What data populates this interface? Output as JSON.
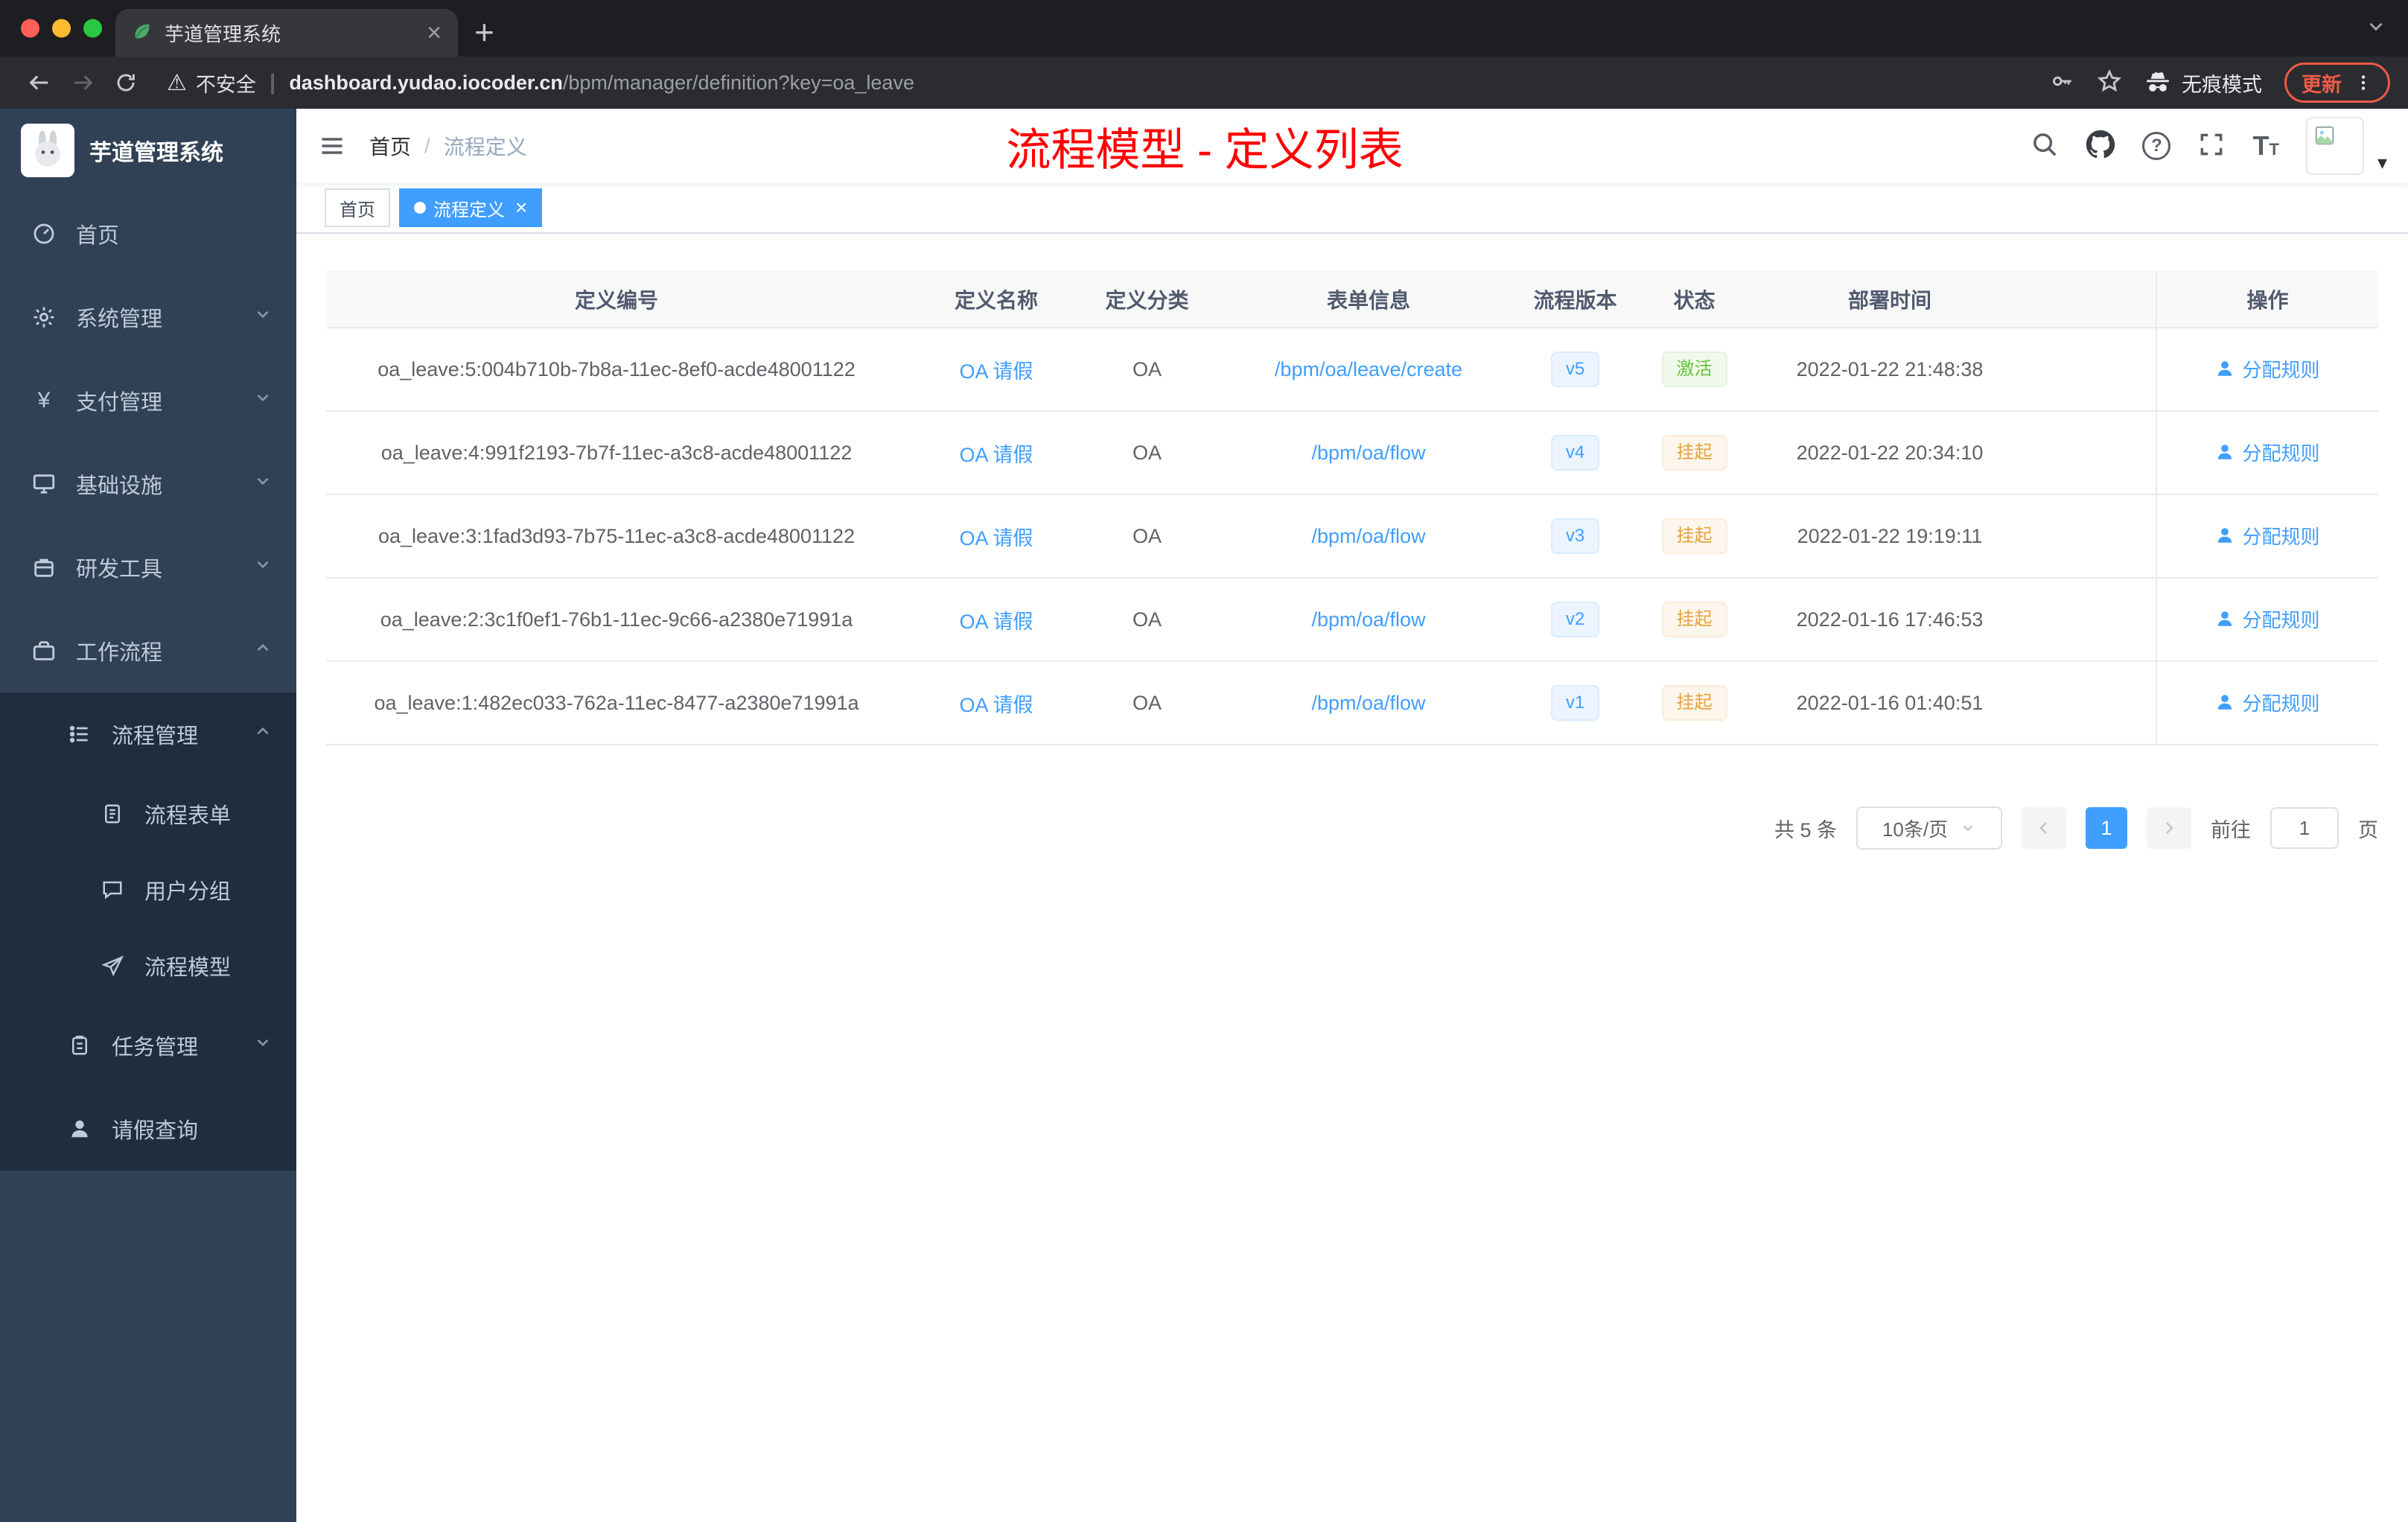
{
  "browser": {
    "tab_title": "芋道管理系统",
    "security_label": "不安全",
    "url_domain": "dashboard.yudao.iocoder.cn",
    "url_path": "/bpm/manager/definition?key=oa_leave",
    "incognito_label": "无痕模式",
    "update_label": "更新"
  },
  "icons": {
    "yen": "¥",
    "close": "×",
    "plus": "+",
    "caret_down": "▾",
    "warning": "⚠",
    "divider": "|",
    "question": "?",
    "font_big": "T",
    "font_small": "T"
  },
  "sidebar": {
    "logo_title": "芋道管理系统",
    "menu": [
      {
        "label": "首页"
      },
      {
        "label": "系统管理"
      },
      {
        "label": "支付管理"
      },
      {
        "label": "基础设施"
      },
      {
        "label": "研发工具"
      },
      {
        "label": "工作流程"
      },
      {
        "label": "流程管理"
      },
      {
        "label": "流程表单"
      },
      {
        "label": "用户分组"
      },
      {
        "label": "流程模型"
      },
      {
        "label": "任务管理"
      },
      {
        "label": "请假查询"
      }
    ]
  },
  "navbar": {
    "breadcrumb_home": "首页",
    "breadcrumb_sep": "/",
    "breadcrumb_current": "流程定义",
    "page_title": "流程模型 - 定义列表"
  },
  "tags": {
    "home": "首页",
    "current": "流程定义"
  },
  "table": {
    "headers": [
      "定义编号",
      "定义名称",
      "定义分类",
      "表单信息",
      "流程版本",
      "状态",
      "部署时间",
      "操作"
    ],
    "rows": [
      {
        "id": "oa_leave:5:004b710b-7b8a-11ec-8ef0-acde48001122",
        "name": "OA 请假",
        "category": "OA",
        "form": "/bpm/oa/leave/create",
        "version": "v5",
        "status": "激活",
        "status_type": "success",
        "time": "2022-01-22 21:48:38",
        "action": "分配规则"
      },
      {
        "id": "oa_leave:4:991f2193-7b7f-11ec-a3c8-acde48001122",
        "name": "OA 请假",
        "category": "OA",
        "form": "/bpm/oa/flow",
        "version": "v4",
        "status": "挂起",
        "status_type": "warning",
        "time": "2022-01-22 20:34:10",
        "action": "分配规则"
      },
      {
        "id": "oa_leave:3:1fad3d93-7b75-11ec-a3c8-acde48001122",
        "name": "OA 请假",
        "category": "OA",
        "form": "/bpm/oa/flow",
        "version": "v3",
        "status": "挂起",
        "status_type": "warning",
        "time": "2022-01-22 19:19:11",
        "action": "分配规则"
      },
      {
        "id": "oa_leave:2:3c1f0ef1-76b1-11ec-9c66-a2380e71991a",
        "name": "OA 请假",
        "category": "OA",
        "form": "/bpm/oa/flow",
        "version": "v2",
        "status": "挂起",
        "status_type": "warning",
        "time": "2022-01-16 17:46:53",
        "action": "分配规则"
      },
      {
        "id": "oa_leave:1:482ec033-762a-11ec-8477-a2380e71991a",
        "name": "OA 请假",
        "category": "OA",
        "form": "/bpm/oa/flow",
        "version": "v1",
        "status": "挂起",
        "status_type": "warning",
        "time": "2022-01-16 01:40:51",
        "action": "分配规则"
      }
    ]
  },
  "pagination": {
    "total": "共 5 条",
    "page_size": "10条/页",
    "current_page": "1",
    "goto_label": "前往",
    "goto_value": "1",
    "page_unit": "页"
  },
  "colors": {
    "accent_blue": "#409eff",
    "success_green": "#67c23a",
    "warning_orange": "#e6a23c",
    "title_red": "#ff0000",
    "sidebar_bg": "#304156",
    "submenu_bg": "#1f2d3d"
  }
}
